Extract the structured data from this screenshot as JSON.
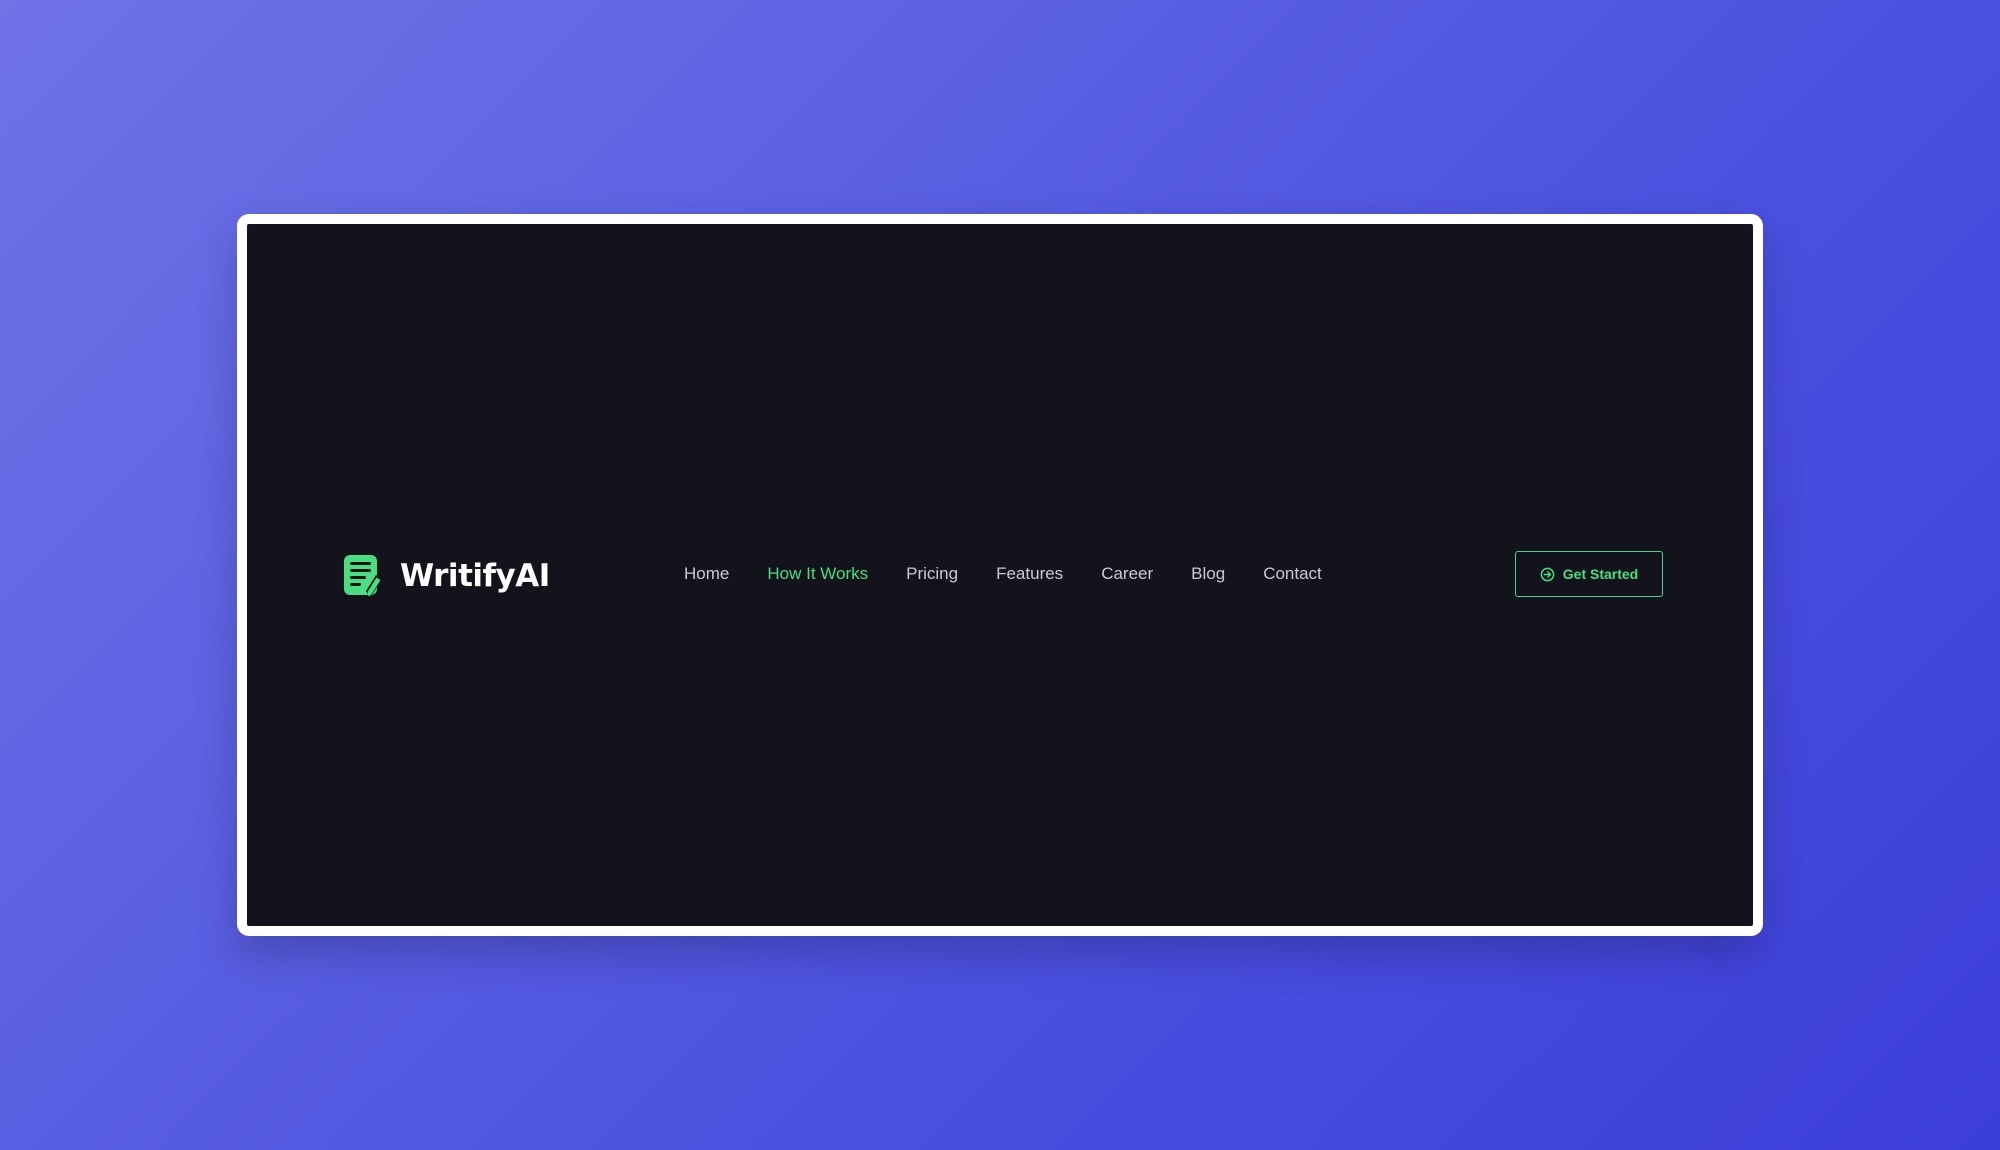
{
  "brand": {
    "name": "WritifyAI",
    "logo_icon": "document-pen-icon",
    "accent_color": "#4ade80"
  },
  "nav": {
    "items": [
      {
        "label": "Home",
        "active": false
      },
      {
        "label": "How It Works",
        "active": true
      },
      {
        "label": "Pricing",
        "active": false
      },
      {
        "label": "Features",
        "active": false
      },
      {
        "label": "Career",
        "active": false
      },
      {
        "label": "Blog",
        "active": false
      },
      {
        "label": "Contact",
        "active": false
      }
    ]
  },
  "cta": {
    "label": "Get Started",
    "icon": "arrow-circle-right-icon"
  },
  "colors": {
    "background_gradient_start": "#6f73e6",
    "background_gradient_end": "#3c3ed8",
    "screen_background": "#12131b",
    "nav_text": "#c9cad3",
    "nav_active": "#4ade80"
  }
}
